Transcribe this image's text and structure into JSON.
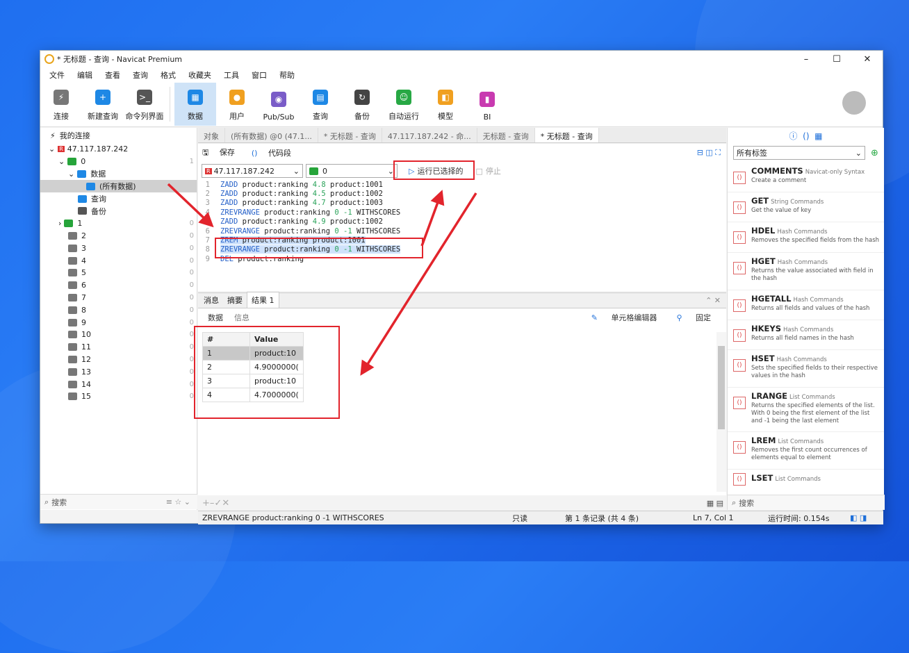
{
  "window": {
    "title": "* 无标题 - 查询 - Navicat Premium",
    "min": "–",
    "max": "☐",
    "close": "✕"
  },
  "menu": [
    "文件",
    "编辑",
    "查看",
    "查询",
    "格式",
    "收藏夹",
    "工具",
    "窗口",
    "帮助"
  ],
  "toolbar": [
    {
      "label": "连接",
      "icon": "plug-icon",
      "color": "#666"
    },
    {
      "label": "新建查询",
      "icon": "new-query-icon",
      "color": "#1e88e5"
    },
    {
      "label": "命令列界面",
      "icon": "terminal-icon",
      "color": "#555"
    },
    {
      "label": "数据",
      "icon": "table-icon",
      "color": "#1e88e5",
      "selected": true
    },
    {
      "label": "用户",
      "icon": "user-icon",
      "color": "#f0a020"
    },
    {
      "label": "Pub/Sub",
      "icon": "broadcast-icon",
      "color": "#7a5cc8"
    },
    {
      "label": "查询",
      "icon": "query-icon",
      "color": "#1e88e5"
    },
    {
      "label": "备份",
      "icon": "backup-icon",
      "color": "#444"
    },
    {
      "label": "自动运行",
      "icon": "robot-icon",
      "color": "#27a844"
    },
    {
      "label": "模型",
      "icon": "model-icon",
      "color": "#f0a020"
    },
    {
      "label": "BI",
      "icon": "bi-icon",
      "color": "#c83ab0"
    }
  ],
  "left": {
    "header": "我的连接",
    "connection": "47.117.187.242",
    "db0": "0",
    "db0_count": "1",
    "data_folder": "数据",
    "all_data": "(所有数据)",
    "query_folder": "查询",
    "backup_folder": "备份",
    "dbs": [
      {
        "name": "1",
        "n": "0"
      },
      {
        "name": "2",
        "n": "0"
      },
      {
        "name": "3",
        "n": "0"
      },
      {
        "name": "4",
        "n": "0"
      },
      {
        "name": "5",
        "n": "0"
      },
      {
        "name": "6",
        "n": "0"
      },
      {
        "name": "7",
        "n": "0"
      },
      {
        "name": "8",
        "n": "0"
      },
      {
        "name": "9",
        "n": "0"
      },
      {
        "name": "10",
        "n": "0"
      },
      {
        "name": "11",
        "n": "0"
      },
      {
        "name": "12",
        "n": "0"
      },
      {
        "name": "13",
        "n": "0"
      },
      {
        "name": "14",
        "n": "0"
      },
      {
        "name": "15",
        "n": "0"
      }
    ],
    "search": "搜索"
  },
  "tabs": [
    "对象",
    "(所有数据) @0 (47.1...",
    "* 无标题 - 查询",
    "47.117.187.242 - 命...",
    "无标题 - 查询",
    "* 无标题 - 查询"
  ],
  "subtoolbar": {
    "save": "保存",
    "snippet": "代码段"
  },
  "conn": {
    "server": "47.117.187.242",
    "db": "0",
    "run": "运行已选择的",
    "stop": "停止"
  },
  "code": [
    {
      "n": "1",
      "cmd": "ZADD",
      "rest": " product:ranking ",
      "num": "4.8",
      "tail": " product:1001"
    },
    {
      "n": "2",
      "cmd": "ZADD",
      "rest": " product:ranking ",
      "num": "4.5",
      "tail": " product:1002"
    },
    {
      "n": "3",
      "cmd": "ZADD",
      "rest": " product:ranking ",
      "num": "4.7",
      "tail": " product:1003"
    },
    {
      "n": "4",
      "cmd": "ZREVRANGE",
      "rest": " product:ranking ",
      "num": "0 -1",
      "tail": " WITHSCORES"
    },
    {
      "n": "5",
      "cmd": "ZADD",
      "rest": " product:ranking ",
      "num": "4.9",
      "tail": " product:1002"
    },
    {
      "n": "6",
      "cmd": "ZREVRANGE",
      "rest": " product:ranking ",
      "num": "0 -1",
      "tail": " WITHSCORES"
    },
    {
      "n": "7",
      "cmd": "ZREM",
      "rest": " product:ranking product:1001",
      "num": "",
      "tail": ""
    },
    {
      "n": "8",
      "cmd": "ZREVRANGE",
      "rest": " product:ranking ",
      "num": "0 -1",
      "tail": " WITHSCORES"
    },
    {
      "n": "9",
      "cmd": "DEL",
      "rest": " product:ranking",
      "num": "",
      "tail": ""
    }
  ],
  "results": {
    "tabs": [
      "消息",
      "摘要",
      "结果 1"
    ],
    "sub": [
      "数据",
      "信息"
    ],
    "cell_editor": "单元格编辑器",
    "pin": "固定",
    "columns": [
      "#",
      "Value"
    ],
    "rows": [
      [
        "1",
        "product:10"
      ],
      [
        "2",
        "4.9000000("
      ],
      [
        "3",
        "product:10"
      ],
      [
        "4",
        "4.7000000("
      ]
    ]
  },
  "status": {
    "query": "ZREVRANGE product:ranking 0 -1 WITHSCORES",
    "readonly": "只读",
    "records": "第 1 条记录 (共 4 条)",
    "pos": "Ln 7, Col 1",
    "time": "运行时间: 0.154s"
  },
  "right": {
    "tags": "所有标签",
    "search": "搜索",
    "snippets": [
      {
        "t": "COMMENTS",
        "c": "Navicat-only Syntax",
        "d": "Create a comment"
      },
      {
        "t": "GET",
        "c": "String Commands",
        "d": "Get the value of key"
      },
      {
        "t": "HDEL",
        "c": "Hash Commands",
        "d": "Removes the specified fields from the hash"
      },
      {
        "t": "HGET",
        "c": "Hash Commands",
        "d": "Returns the value associated with field in the hash"
      },
      {
        "t": "HGETALL",
        "c": "Hash Commands",
        "d": "Returns all fields and values of the hash"
      },
      {
        "t": "HKEYS",
        "c": "Hash Commands",
        "d": "Returns all field names in the hash"
      },
      {
        "t": "HSET",
        "c": "Hash Commands",
        "d": "Sets the specified fields to their respective values in the hash"
      },
      {
        "t": "LRANGE",
        "c": "List Commands",
        "d": "Returns the specified elements of the list. With 0 being the first element of the list and -1 being the last element"
      },
      {
        "t": "LREM",
        "c": "List Commands",
        "d": "Removes the first count occurrences of elements equal to element"
      },
      {
        "t": "LSET",
        "c": "List Commands",
        "d": ""
      }
    ]
  }
}
